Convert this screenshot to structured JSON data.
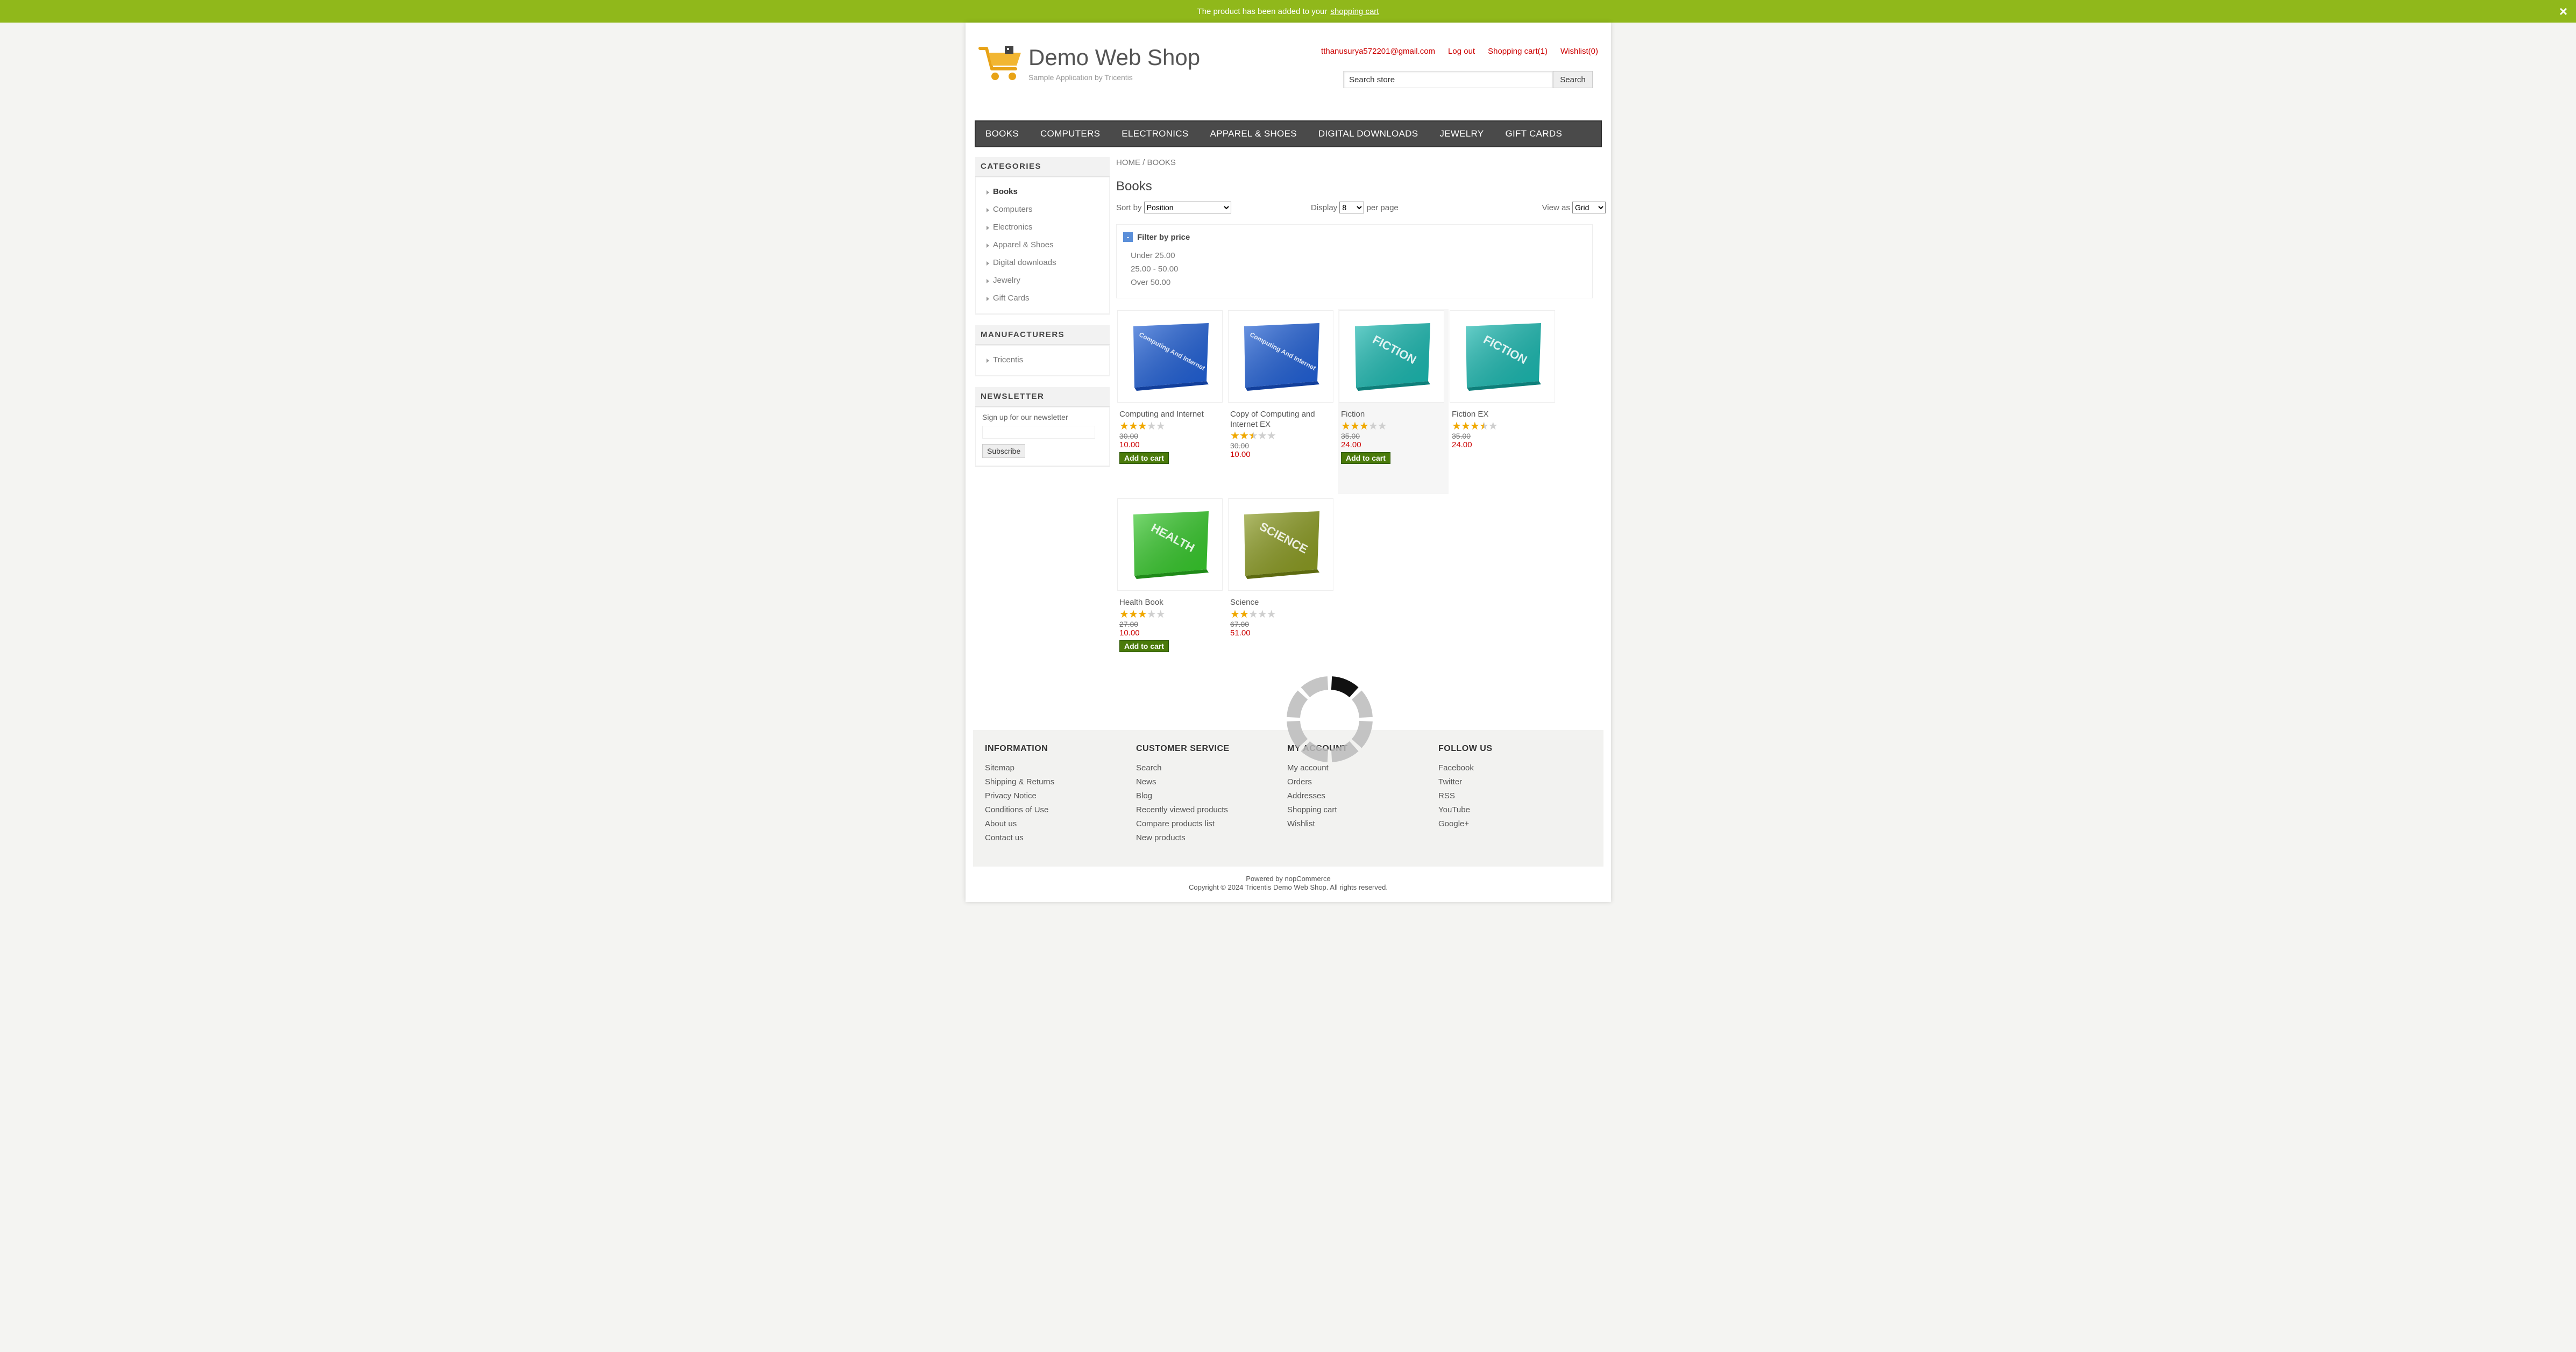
{
  "notification": {
    "text": "The product has been added to your",
    "link": "shopping cart",
    "close": "×"
  },
  "header": {
    "logo_title": "Demo Web Shop",
    "logo_subtitle": "Sample Application by Tricentis",
    "links": {
      "account": "tthanusurya572201@gmail.com",
      "logout": "Log out",
      "cart": "Shopping cart(1)",
      "wishlist": "Wishlist(0)"
    },
    "search_value": "Search store",
    "search_button": "Search"
  },
  "menu": [
    "BOOKS",
    "COMPUTERS",
    "ELECTRONICS",
    "APPAREL & SHOES",
    "DIGITAL DOWNLOADS",
    "JEWELRY",
    "GIFT CARDS"
  ],
  "categories": {
    "title": "CATEGORIES",
    "items": [
      "Books",
      "Computers",
      "Electronics",
      "Apparel & Shoes",
      "Digital downloads",
      "Jewelry",
      "Gift Cards"
    ]
  },
  "manufacturers": {
    "title": "MANUFACTURERS",
    "items": [
      "Tricentis"
    ]
  },
  "newsletter": {
    "title": "NEWSLETTER",
    "text": "Sign up for our newsletter",
    "button": "Subscribe"
  },
  "breadcrumb": {
    "home": "HOME",
    "sep": " / ",
    "current": "BOOKS"
  },
  "page_title": "Books",
  "selectors": {
    "sort_label": "Sort by",
    "sort_value": "Position",
    "display_label": "Display",
    "display_value": "8",
    "display_suffix": "per page",
    "view_label": "View as",
    "view_value": "Grid"
  },
  "filter": {
    "toggle": "-",
    "title": "Filter by price",
    "ranges": [
      "Under 25.00",
      "25.00 - 50.00",
      "Over 50.00"
    ]
  },
  "products": [
    {
      "name": "Computing and Internet",
      "rating": 3,
      "old_price": "30.00",
      "price": "10.00",
      "button": "Add to cart",
      "cover": "#1f5fd6",
      "cover_dark": "#123f9c",
      "cover_text": "Computing And Internet"
    },
    {
      "name": "Copy of Computing and Internet EX",
      "rating": 2.5,
      "old_price": "30.00",
      "price": "10.00",
      "button": "",
      "cover": "#1f5fd6",
      "cover_dark": "#123f9c",
      "cover_text": "Computing And Internet"
    },
    {
      "name": "Fiction",
      "rating": 3,
      "old_price": "35.00",
      "price": "24.00",
      "button": "Add to cart",
      "cover": "#18b8b0",
      "cover_dark": "#0e7f7a",
      "cover_text": "FICTION"
    },
    {
      "name": "Fiction EX",
      "rating": 3.5,
      "old_price": "35.00",
      "price": "24.00",
      "button": "",
      "cover": "#18b8b0",
      "cover_dark": "#0e7f7a",
      "cover_text": "FICTION"
    },
    {
      "name": "Health Book",
      "rating": 3,
      "old_price": "27.00",
      "price": "10.00",
      "button": "Add to cart",
      "cover": "#35c82a",
      "cover_dark": "#1f8a18",
      "cover_text": "HEALTH"
    },
    {
      "name": "Science",
      "rating": 2,
      "old_price": "67.00",
      "price": "51.00",
      "button": "",
      "cover": "#8a9a20",
      "cover_dark": "#5d6a10",
      "cover_text": "SCIENCE"
    }
  ],
  "footer": {
    "columns": [
      {
        "title": "INFORMATION",
        "links": [
          "Sitemap",
          "Shipping & Returns",
          "Privacy Notice",
          "Conditions of Use",
          "About us",
          "Contact us"
        ]
      },
      {
        "title": "CUSTOMER SERVICE",
        "links": [
          "Search",
          "News",
          "Blog",
          "Recently viewed products",
          "Compare products list",
          "New products"
        ]
      },
      {
        "title": "MY ACCOUNT",
        "links": [
          "My account",
          "Orders",
          "Addresses",
          "Shopping cart",
          "Wishlist"
        ]
      },
      {
        "title": "FOLLOW US",
        "links": [
          "Facebook",
          "Twitter",
          "RSS",
          "YouTube",
          "Google+"
        ]
      }
    ],
    "powered": "Powered by nopCommerce",
    "copyright": "Copyright © 2024 Tricentis Demo Web Shop. All rights reserved."
  },
  "colors": {
    "notification": "#90b81b",
    "link_red": "#cc0000",
    "menu": "#4a4a4a",
    "add_to_cart": "#4a7a0a",
    "star": "#f0a800"
  },
  "icons": {
    "logo": "shopping-cart-icon",
    "close": "close-icon",
    "loading": "loading-spinner-icon"
  }
}
